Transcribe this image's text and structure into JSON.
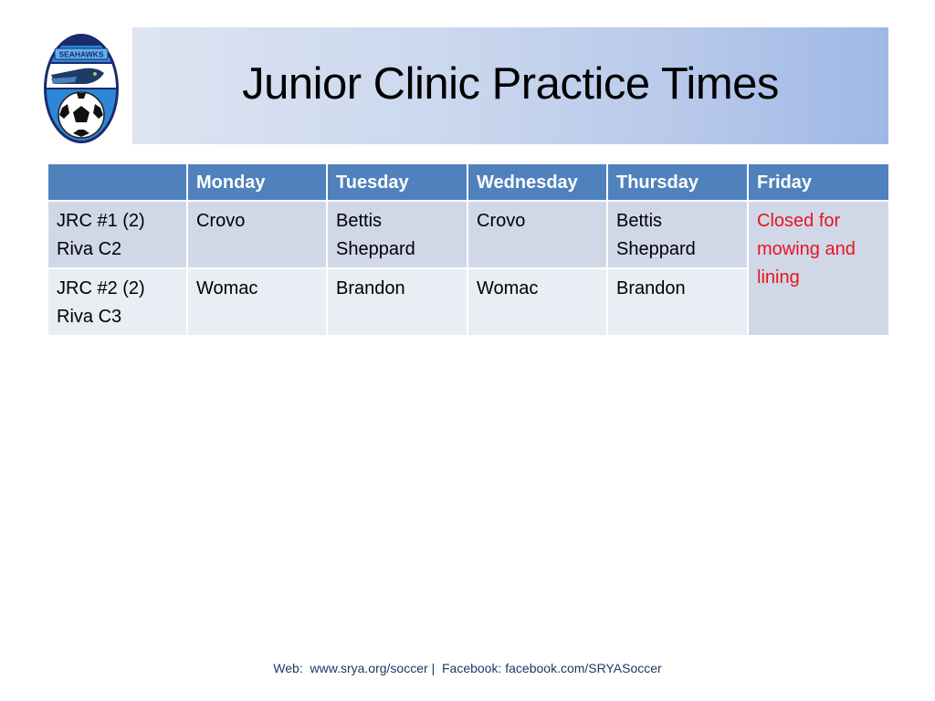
{
  "logo": {
    "name": "Seahawks soccer logo",
    "banner_text": "SEAHAWKS"
  },
  "title": "Junior Clinic Practice Times",
  "table": {
    "headers": [
      "",
      "Monday",
      "Tuesday",
      "Wednesday",
      "Thursday",
      "Friday"
    ],
    "rows": [
      {
        "team_line1": "JRC #1 (2)",
        "team_line2": "Riva C2",
        "monday": "Crovo",
        "tuesday_line1": "Bettis",
        "tuesday_line2": "Sheppard",
        "wednesday": "Crovo",
        "thursday_line1": "Bettis",
        "thursday_line2": "Sheppard"
      },
      {
        "team_line1": "JRC #2 (2)",
        "team_line2": "Riva C3",
        "monday": "Womac",
        "tuesday": "Brandon",
        "wednesday": "Womac",
        "thursday": "Brandon"
      }
    ],
    "friday_note": "Closed for mowing and lining",
    "friday_note_color": "#e8141c",
    "header_color": "#4f81bd"
  },
  "footer": {
    "web_label": "Web:",
    "web_url": "www.srya.org/soccer",
    "separator": "|",
    "facebook_label": "Facebook:",
    "facebook_url": "facebook.com/SRYASoccer"
  }
}
